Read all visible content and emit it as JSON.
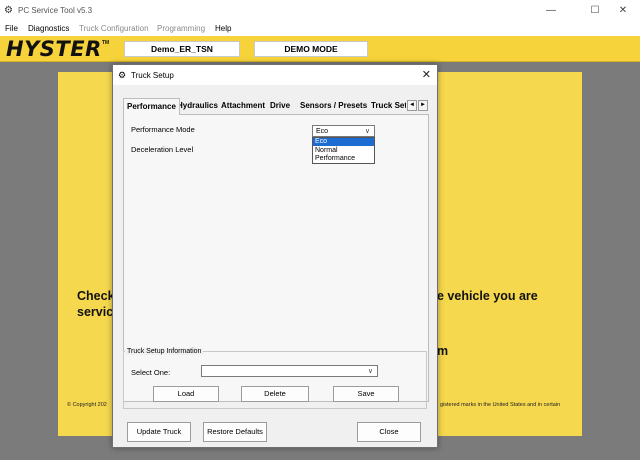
{
  "window": {
    "title": "PC Service Tool v5.3",
    "controls": {
      "minimize": "—",
      "maximize": "☐",
      "close": "✕"
    }
  },
  "menu": {
    "items": [
      "File",
      "Diagnostics",
      "Truck Configuration",
      "Programming",
      "Help"
    ]
  },
  "brand": {
    "logo": "HYSTER",
    "logo_mark": "TM",
    "truck_name": "Demo_ER_TSN",
    "mode": "DEMO MODE"
  },
  "background": {
    "line1_left": "Check",
    "line2_left": "servic",
    "line1_right": "e vehicle you are",
    "line2_right": "m",
    "copyright_left": "© Copyright 202",
    "copyright_right": "gistered marks in the United States and in certain"
  },
  "dialog": {
    "title": "Truck Setup",
    "close_glyph": "✕",
    "tabs": [
      "Performance",
      "Hydraulics",
      "Attachment",
      "Drive",
      "Sensors / Presets",
      "Truck Setup"
    ],
    "active_tab": "Performance",
    "tab_scroll_left": "◄",
    "tab_scroll_right": "►",
    "fields": {
      "performance_mode_label": "Performance Mode",
      "performance_mode_value": "Eco",
      "deceleration_label": "Deceleration Level"
    },
    "dropdown_options": [
      "Eco",
      "Normal",
      "Performance"
    ],
    "dropdown_selected": "Eco",
    "info_group": {
      "title": "Truck Setup Information",
      "select_label": "Select One:",
      "select_value": ""
    },
    "buttons": {
      "load": "Load",
      "delete": "Delete",
      "save": "Save",
      "update_truck": "Update Truck",
      "restore_defaults": "Restore Defaults",
      "close": "Close"
    }
  },
  "colors": {
    "brand_yellow": "#f6d33a",
    "panel_yellow": "#f6d84e",
    "backdrop_gray": "#7b7b7b",
    "selection_blue": "#1c6cd2"
  }
}
